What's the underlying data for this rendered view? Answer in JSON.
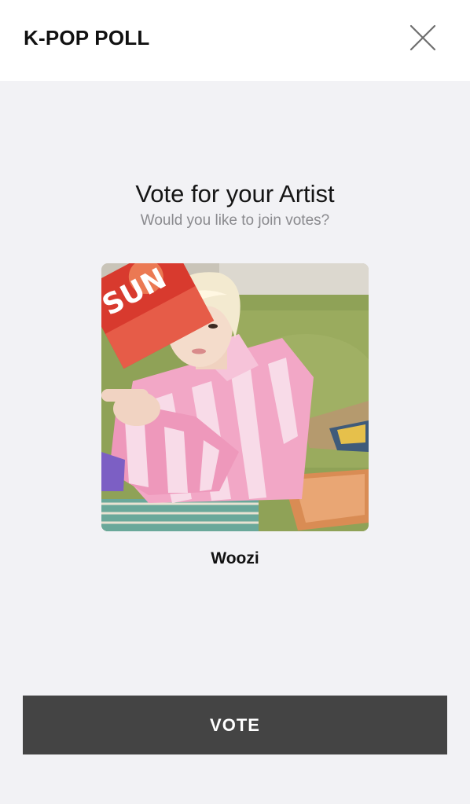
{
  "header": {
    "title": "K-POP POLL",
    "close_icon": "close-icon"
  },
  "main": {
    "heading": "Vote for your Artist",
    "subheading": "Would you like to join votes?",
    "artist": {
      "name": "Woozi",
      "magazine_text": "SUN"
    },
    "vote_button_label": "VOTE"
  },
  "colors": {
    "header_bg": "#ffffff",
    "page_bg": "#f2f2f5",
    "vote_button_bg": "#444444",
    "subheading_text": "#8a8a8e"
  }
}
